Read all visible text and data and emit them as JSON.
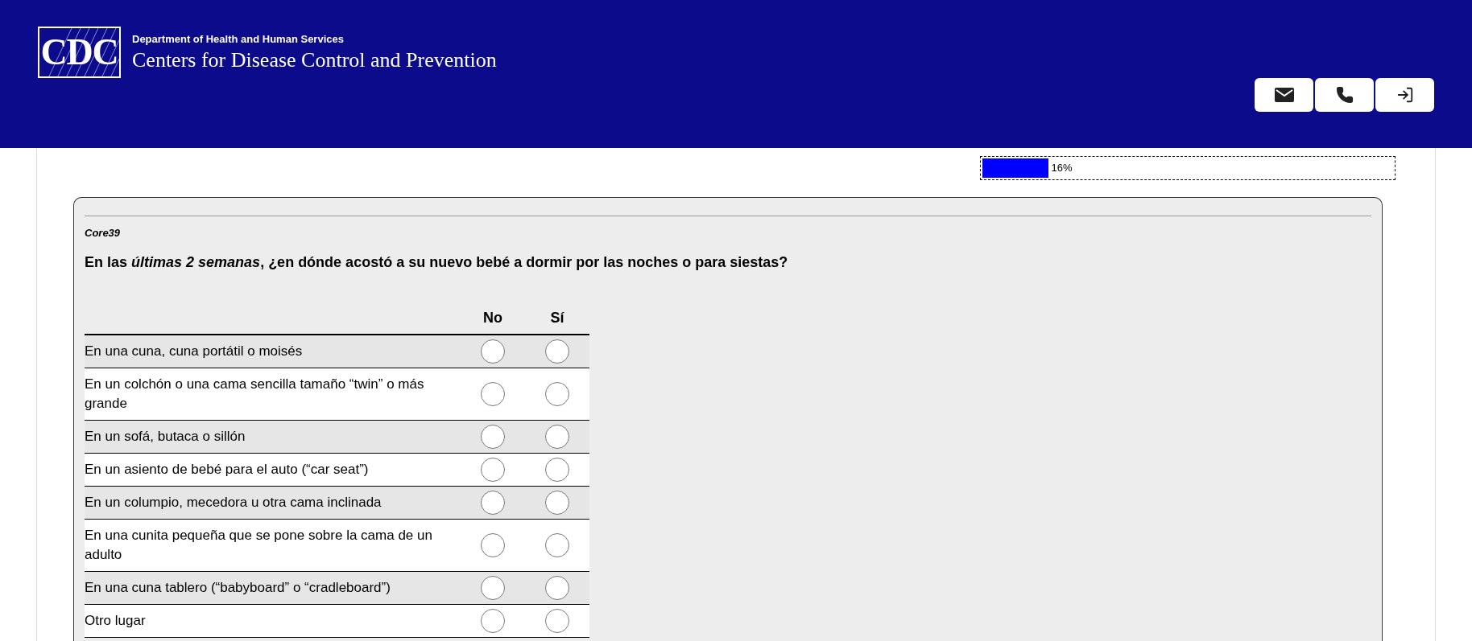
{
  "header": {
    "logo": "CDC",
    "department": "Department of Health and Human Services",
    "agency": "Centers for Disease Control and Prevention",
    "buttons": [
      {
        "kind": "mail"
      },
      {
        "kind": "phone"
      },
      {
        "kind": "exit"
      }
    ]
  },
  "progress": {
    "level": 0.16,
    "reading": "16%"
  },
  "question": {
    "code": "Core39",
    "text": "En las *últimas 2 semanas*, ¿en dónde acostó a su nuevo bebé a dormir por las noches o para siestas?",
    "columns": [
      "No",
      "Sí"
    ],
    "rows": [
      {
        "label": "En una cuna, cuna portátil o moisés",
        "choices": [
          {
            "selected": false
          },
          {
            "selected": false
          }
        ]
      },
      {
        "label": "En un colchón o una cama sencilla tamaño “twin” o más grande",
        "choices": [
          {
            "selected": false
          },
          {
            "selected": false
          }
        ]
      },
      {
        "label": "En un sofá, butaca o sillón",
        "choices": [
          {
            "selected": false
          },
          {
            "selected": false
          }
        ]
      },
      {
        "label": "En un asiento de bebé para el auto (“car seat”)",
        "choices": [
          {
            "selected": false
          },
          {
            "selected": false
          }
        ]
      },
      {
        "label": "En un columpio, mecedora u otra cama inclinada",
        "choices": [
          {
            "selected": false
          },
          {
            "selected": false
          }
        ]
      },
      {
        "label": "En una cunita pequeña que se pone sobre la cama de un adulto",
        "choices": [
          {
            "selected": false
          },
          {
            "selected": false
          }
        ]
      },
      {
        "label": "En una cuna tablero (“babyboard” o “cradleboard”)",
        "choices": [
          {
            "selected": false
          },
          {
            "selected": false
          }
        ]
      },
      {
        "label": "Otro lugar",
        "choices": [
          {
            "selected": false
          },
          {
            "selected": false
          }
        ]
      }
    ]
  }
}
